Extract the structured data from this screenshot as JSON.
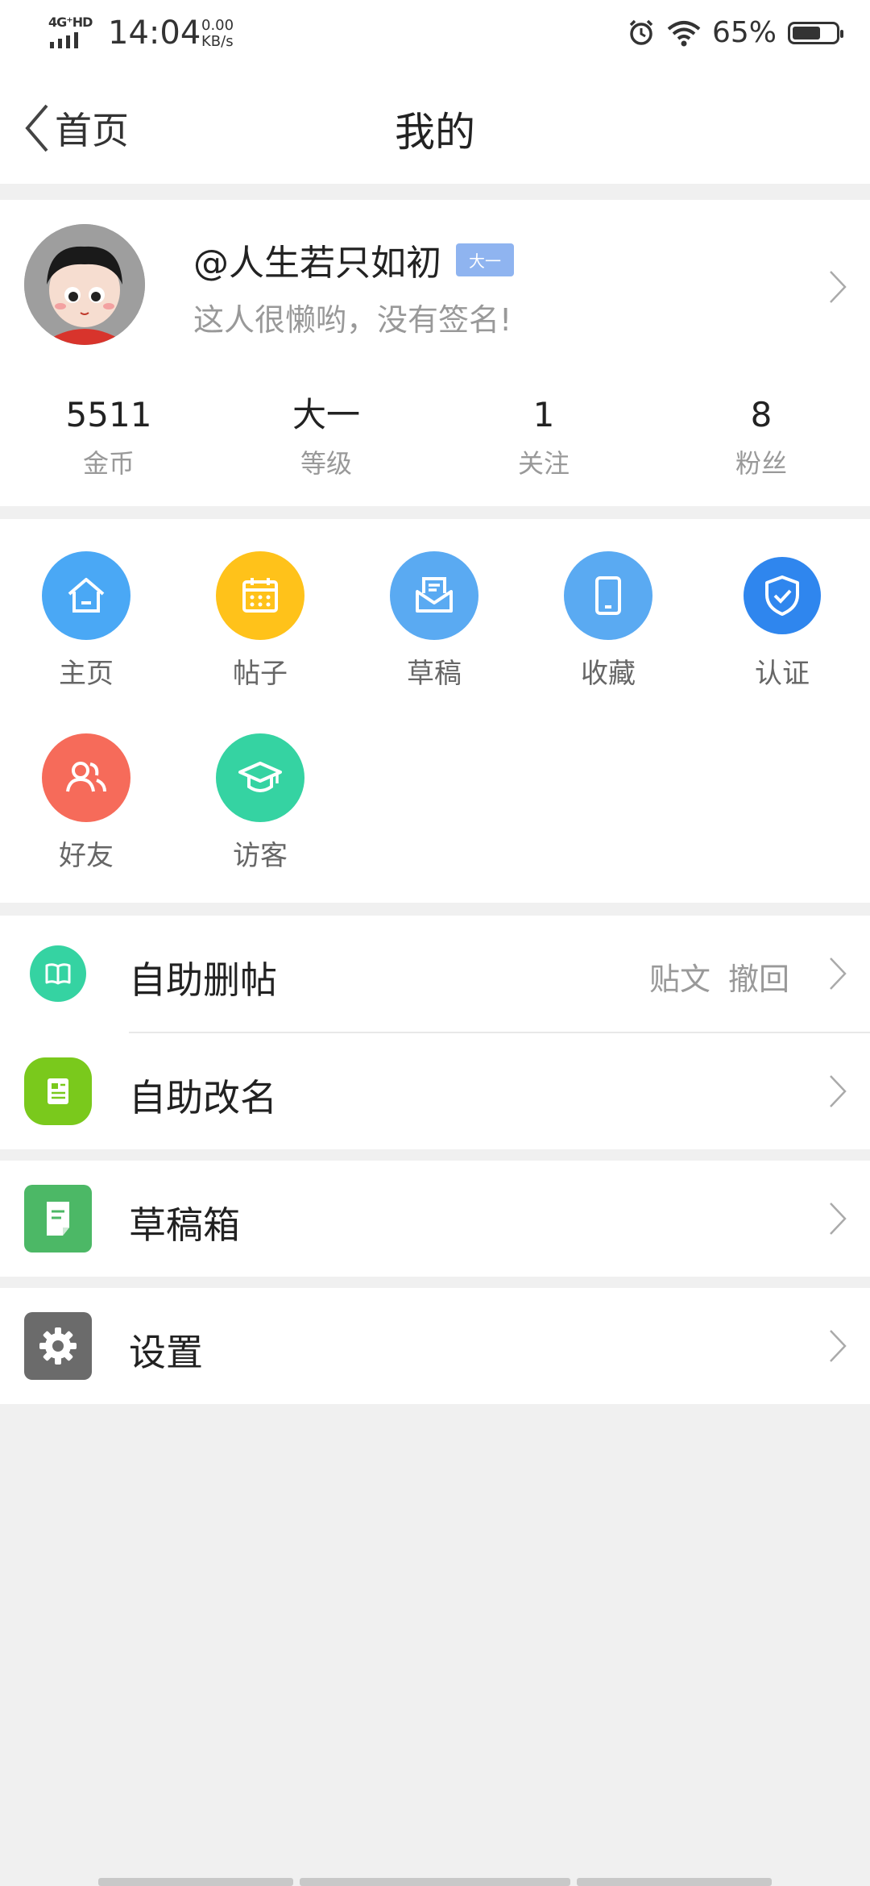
{
  "status_bar": {
    "network": "4G⁺HD",
    "time": "14:04",
    "speed_value": "0.00",
    "speed_unit": "KB/s",
    "battery": "65%",
    "battery_level": 0.65
  },
  "nav": {
    "back_label": "首页",
    "title": "我的"
  },
  "profile": {
    "name": "@人生若只如初",
    "level_badge": "大一",
    "signature": "这人很懒哟，没有签名!",
    "stats": [
      {
        "value": "5511",
        "label": "金币"
      },
      {
        "value": "大一",
        "label": "等级"
      },
      {
        "value": "1",
        "label": "关注"
      },
      {
        "value": "8",
        "label": "粉丝"
      }
    ]
  },
  "shortcuts": [
    {
      "label": "主页",
      "icon": "home-icon",
      "color": "#4aa8f5"
    },
    {
      "label": "帖子",
      "icon": "calendar-icon",
      "color": "#ffc21a"
    },
    {
      "label": "草稿",
      "icon": "envelope-icon",
      "color": "#5aaaf2"
    },
    {
      "label": "收藏",
      "icon": "tablet-icon",
      "color": "#5aaaf2"
    },
    {
      "label": "认证",
      "icon": "shield-check-icon",
      "color": "#2f86ee"
    },
    {
      "label": "好友",
      "icon": "friends-icon",
      "color": "#f66b5a"
    },
    {
      "label": "访客",
      "icon": "graduation-cap-icon",
      "color": "#35d3a2"
    }
  ],
  "menu": {
    "self_delete": {
      "label": "自助删帖",
      "extra_1": "贴文",
      "extra_2": "撤回",
      "icon": "book-icon",
      "color": "#35d3a2"
    },
    "self_rename": {
      "label": "自助改名",
      "icon": "id-card-icon",
      "color": "#7ac91c"
    },
    "drafts": {
      "label": "草稿箱",
      "icon": "document-icon",
      "color": "#4cb866"
    },
    "settings": {
      "label": "设置",
      "icon": "gear-icon",
      "color": "#6b6b6b"
    }
  }
}
